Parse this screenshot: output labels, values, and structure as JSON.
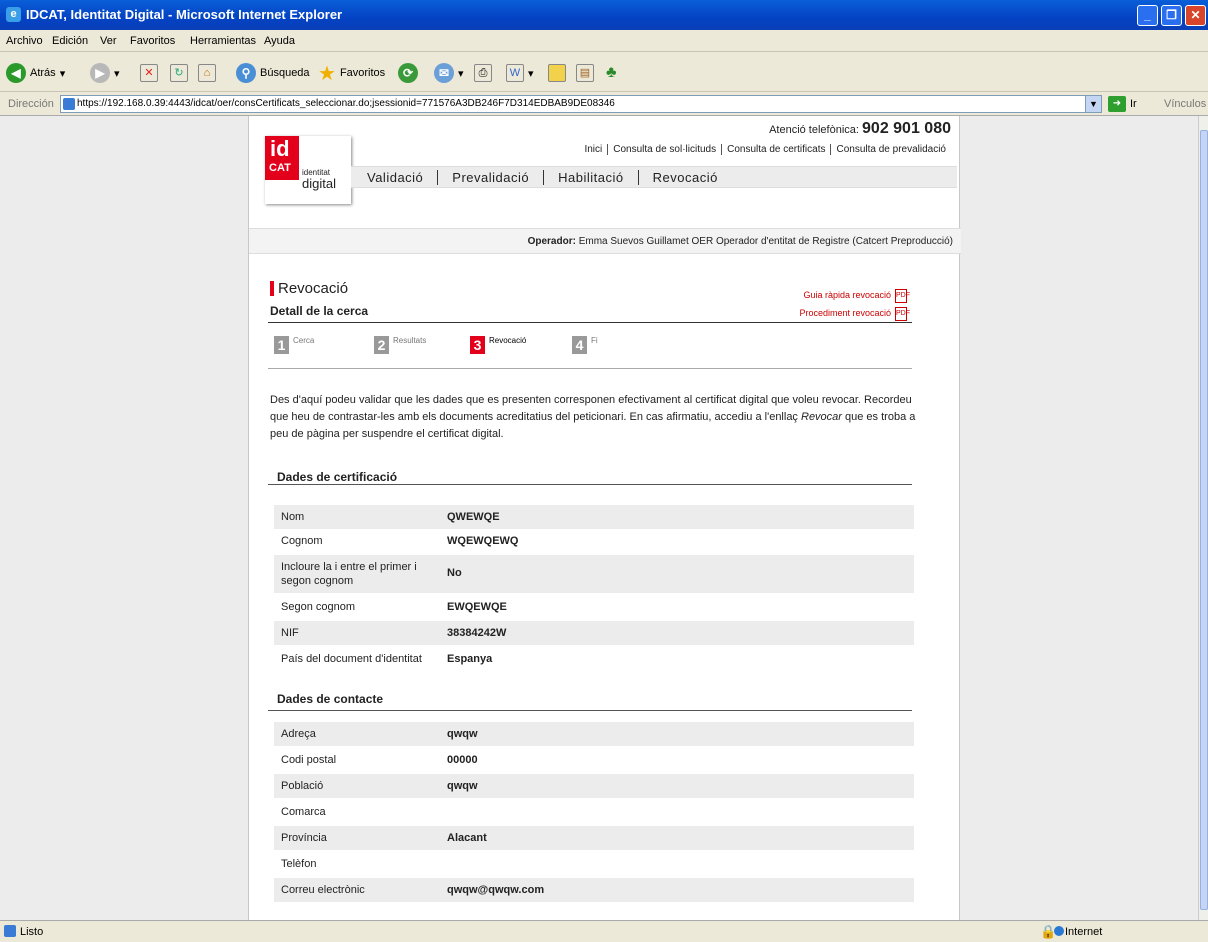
{
  "window": {
    "title": "IDCAT, Identitat Digital - Microsoft Internet Explorer",
    "buttons": [
      "_",
      "❐",
      "✕"
    ]
  },
  "menubar": [
    "Archivo",
    "Edición",
    "Ver",
    "Favoritos",
    "Herramientas",
    "Ayuda"
  ],
  "toolbar": {
    "back": "Atrás",
    "search": "Búsqueda",
    "favorites": "Favoritos"
  },
  "address": {
    "label": "Dirección",
    "url": "https://192.168.0.39:4443/idcat/oer/consCertificats_seleccionar.do;jsessionid=771576A3DB246F7D314EDBAB9DE08346",
    "go": "Ir",
    "links": "Vínculos"
  },
  "site": {
    "logo": {
      "id": "id",
      "cat": "CAT",
      "t1": "identitat",
      "t2": "digital"
    },
    "phone_label": "Atenció telefònica:",
    "phone": "902 901 080",
    "top_links": [
      "Inici",
      "Consulta de sol·licituds",
      "Consulta de certificats",
      "Consulta de prevalidació"
    ],
    "nav": [
      "Validació",
      "Prevalidació",
      "Habilitació",
      "Revocació"
    ],
    "operator_label": "Operador:",
    "operator": "Emma Suevos Guillamet OER  Operador d'entitat de Registre (Catcert Preproducció)"
  },
  "main": {
    "section_title": "Revocació",
    "subtitle": "Detall de la cerca",
    "guide_links": [
      "Guia ràpida revocació",
      "Procediment revocació"
    ],
    "steps": [
      {
        "num": "1",
        "label": "Cerca"
      },
      {
        "num": "2",
        "label": "Resultats"
      },
      {
        "num": "3",
        "label": "Revocació"
      },
      {
        "num": "4",
        "label": "Fi"
      }
    ],
    "intro_1": "Des d'aquí podeu validar que les dades que es presenten corresponen efectivament al certificat digital que voleu revocar. Recordeu que heu de contrastar-les amb els documents acreditatius del peticionari. En cas afirmatiu, accediu a l'enllaç ",
    "intro_em": "Revocar",
    "intro_2": " que es troba a peu de pàgina per suspendre el certificat digital.",
    "cert_heading": "Dades de certificació",
    "cert_rows": [
      {
        "k": "Nom",
        "v": "QWEWQE"
      },
      {
        "k": "Cognom",
        "v": "WQEWQEWQ"
      },
      {
        "k": "Incloure la i entre el primer i segon cognom",
        "v": "No"
      },
      {
        "k": "Segon cognom",
        "v": "EWQEWQE"
      },
      {
        "k": "NIF",
        "v": "38384242W"
      },
      {
        "k": "País del document d'identitat",
        "v": "Espanya"
      }
    ],
    "contact_heading": "Dades de contacte",
    "contact_rows": [
      {
        "k": "Adreça",
        "v": "qwqw"
      },
      {
        "k": "Codi postal",
        "v": "00000"
      },
      {
        "k": "Població",
        "v": "qwqw"
      },
      {
        "k": "Comarca",
        "v": ""
      },
      {
        "k": "Província",
        "v": "Alacant"
      },
      {
        "k": "Telèfon",
        "v": ""
      },
      {
        "k": "Correu electrònic",
        "v": "qwqw@qwqw.com"
      }
    ]
  },
  "status": {
    "text": "Listo",
    "zone": "Internet"
  },
  "colors": {
    "accent": "#e2001a",
    "title_bar": "#0342c4"
  }
}
